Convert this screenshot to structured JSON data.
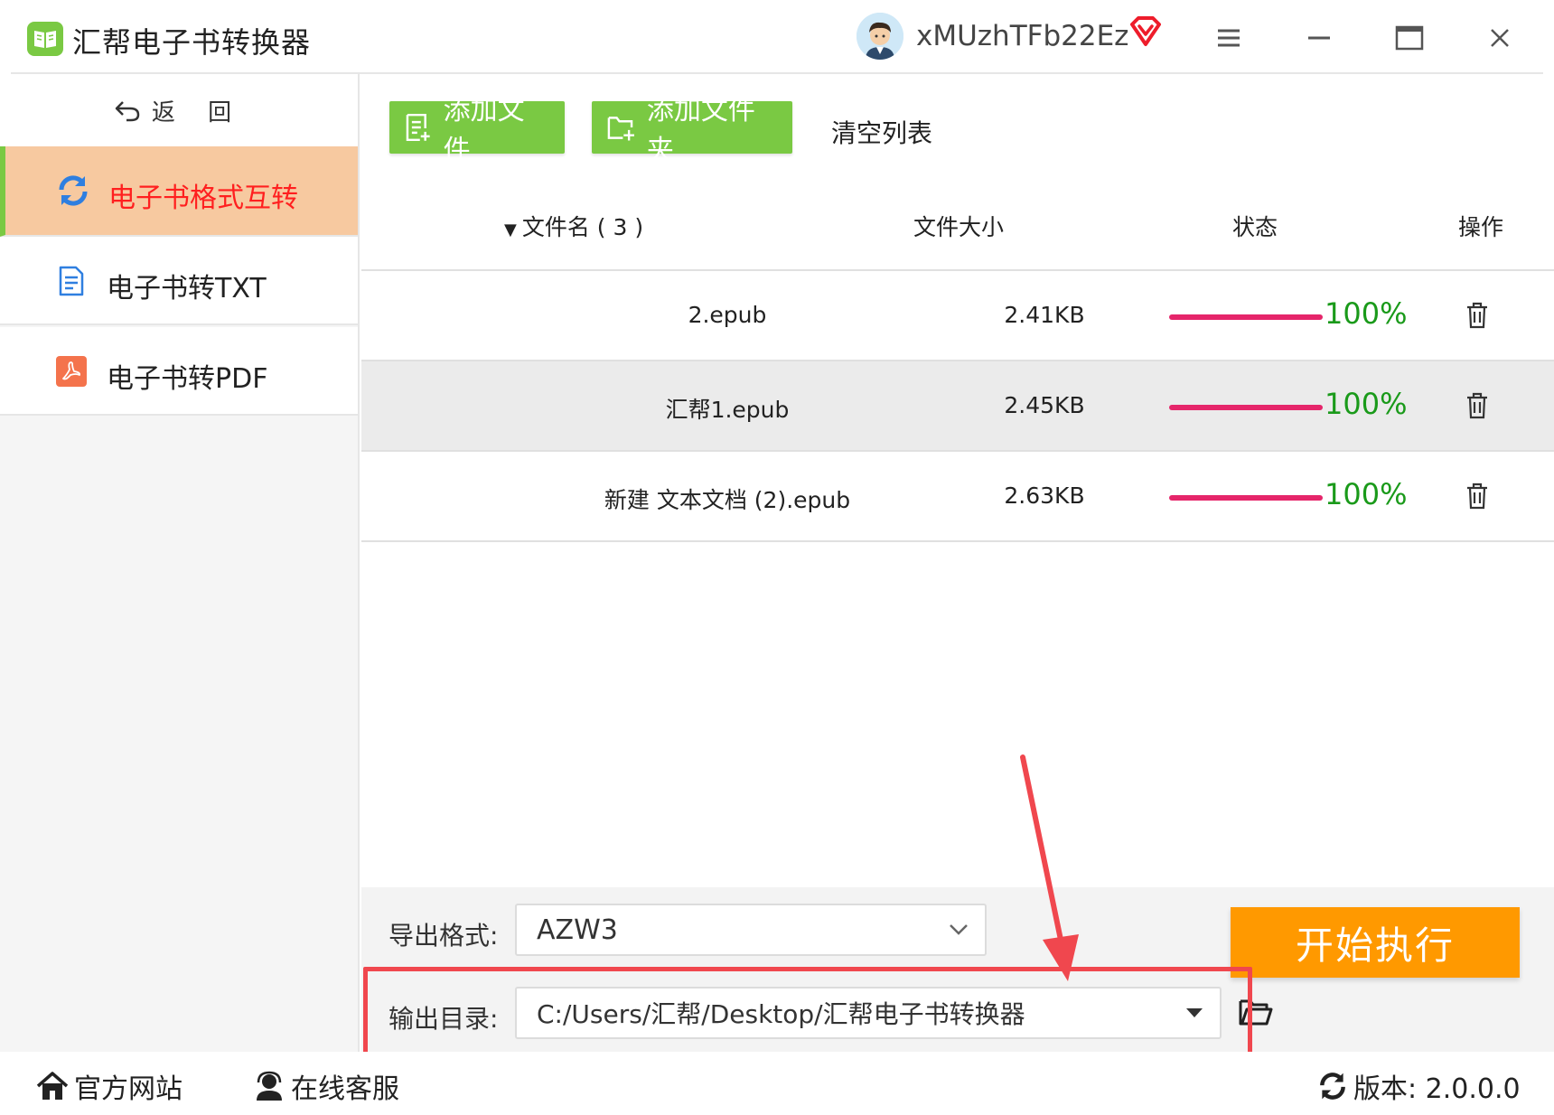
{
  "titlebar": {
    "app_title": "汇帮电子书转换器",
    "username": "xMUzhTFb22Ez"
  },
  "sidebar": {
    "back_label": "返 回",
    "items": [
      {
        "label": "电子书格式互转",
        "icon": "refresh-icon",
        "active": true
      },
      {
        "label": "电子书转TXT",
        "icon": "document-icon",
        "active": false
      },
      {
        "label": "电子书转PDF",
        "icon": "pdf-icon",
        "active": false
      }
    ]
  },
  "toolbar": {
    "add_file": "添加文件",
    "add_folder": "添加文件夹",
    "clear_list": "清空列表"
  },
  "table": {
    "headers": {
      "name": "文件名 ( 3 )",
      "size": "文件大小",
      "status": "状态",
      "action": "操作"
    },
    "rows": [
      {
        "name": "2.epub",
        "size": "2.41KB",
        "status": "100%",
        "progress": 1.0
      },
      {
        "name": "汇帮1.epub",
        "size": "2.45KB",
        "status": "100%",
        "progress": 1.0
      },
      {
        "name": "新建 文本文档 (2).epub",
        "size": "2.63KB",
        "status": "100%",
        "progress": 1.0
      }
    ]
  },
  "settings": {
    "format_label": "导出格式:",
    "format_value": "AZW3",
    "output_label": "输出目录:",
    "output_value": "C:/Users/汇帮/Desktop/汇帮电子书转换器",
    "start_button": "开始执行"
  },
  "statusbar": {
    "website": "官方网站",
    "support": "在线客服",
    "version": "版本: 2.0.0.0"
  },
  "colors": {
    "accent_green": "#7ac943",
    "active_bg": "#f7c9a0",
    "active_text": "#ff1f1f",
    "progress": "#e5256a",
    "percent": "#1a9a1a",
    "start": "#ff9900",
    "highlight": "#f0474e"
  }
}
